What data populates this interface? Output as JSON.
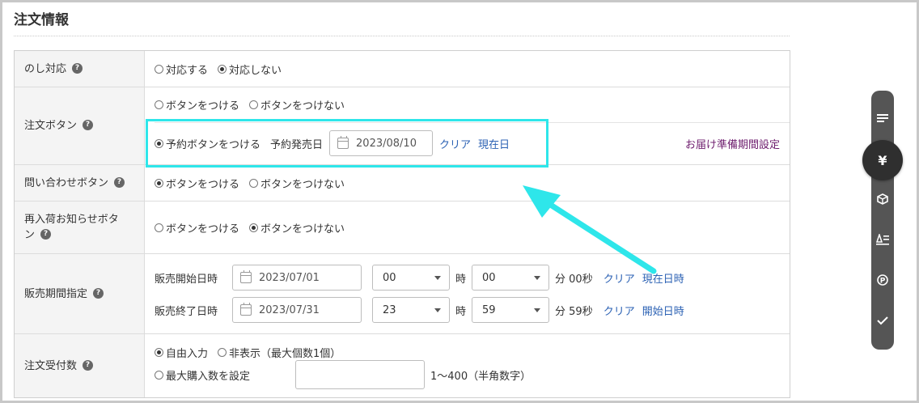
{
  "section_title": "注文情報",
  "rows": {
    "noshi": {
      "label": "のし対応",
      "options": [
        "対応する",
        "対応しない"
      ],
      "selected": 1
    },
    "order_button": {
      "label": "注文ボタン",
      "options": [
        "ボタンをつける",
        "ボタンをつけない"
      ],
      "reserve_option": "予約ボタンをつける",
      "release_date_label": "予約発売日",
      "release_date": "2023/08/10",
      "clear_link": "クリア",
      "today_link": "現在日",
      "delivery_link": "お届け準備期間設定"
    },
    "inquiry_button": {
      "label": "問い合わせボタン",
      "options": [
        "ボタンをつける",
        "ボタンをつけない"
      ],
      "selected": 0
    },
    "restock_button": {
      "label_line1": "再入荷お知らせボタ",
      "label_line2": "ン",
      "options": [
        "ボタンをつける",
        "ボタンをつけない"
      ],
      "selected": 1
    },
    "sales_period": {
      "label": "販売期間指定",
      "start_label": "販売開始日時",
      "start_date": "2023/07/01",
      "start_hour": "00",
      "start_minute": "00",
      "start_seconds": "分 00秒",
      "end_label": "販売終了日時",
      "end_date": "2023/07/31",
      "end_hour": "23",
      "end_minute": "59",
      "end_seconds": "分 59秒",
      "hour_unit": "時",
      "clear_link": "クリア",
      "now_link": "現在日時",
      "start_link": "開始日時"
    },
    "order_count": {
      "label": "注文受付数",
      "free_input": "自由入力",
      "hidden_option": "非表示（最大個数1個）",
      "max_option": "最大購入数を設定",
      "range_note": "1〜400（半角数字）"
    }
  },
  "help_glyph": "?",
  "sidebar": {
    "items": [
      "list-icon",
      "yen-icon",
      "box-icon",
      "text-format-icon",
      "p-circle-icon",
      "check-icon"
    ],
    "active_glyph": "¥"
  },
  "colors": {
    "highlight": "#2ee6ea",
    "link": "#2c62b4",
    "delivery_link": "#6e1d6e",
    "sidebar": "#555555"
  }
}
